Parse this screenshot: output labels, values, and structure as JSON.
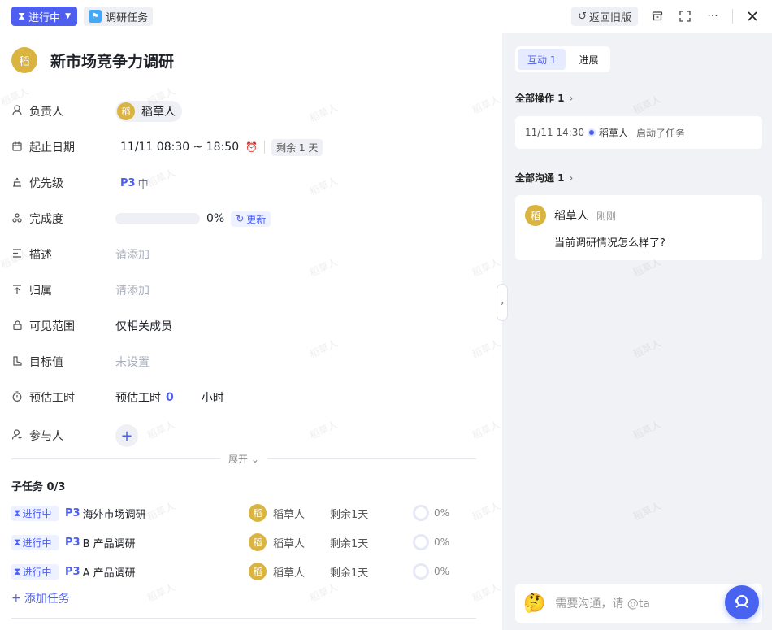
{
  "topbar": {
    "status": "进行中",
    "task_tag": "调研任务",
    "back_label": "返回旧版"
  },
  "task": {
    "avatar_char": "稻",
    "title": "新市场竞争力调研"
  },
  "fields": {
    "owner": {
      "label": "负责人",
      "avatar_char": "稻",
      "name": "稻草人"
    },
    "dates": {
      "label": "起止日期",
      "value": "11/11 08:30 ~ 18:50",
      "remaining": "剩余 1 天"
    },
    "priority": {
      "label": "优先级",
      "level": "P3",
      "text": "中"
    },
    "completion": {
      "label": "完成度",
      "percent": "0%",
      "progress_fraction": 0,
      "update": "更新"
    },
    "description": {
      "label": "描述",
      "placeholder": "请添加"
    },
    "belongs": {
      "label": "归属",
      "placeholder": "请添加"
    },
    "visibility": {
      "label": "可见范围",
      "value": "仅相关成员"
    },
    "target": {
      "label": "目标值",
      "placeholder": "未设置"
    },
    "estimate": {
      "label": "预估工时",
      "prefix": "预估工时",
      "number": "0",
      "unit": "小时"
    },
    "participants": {
      "label": "参与人",
      "add": "+"
    }
  },
  "expand_label": "展开",
  "subtasks": {
    "header": "子任务 0/3",
    "items": [
      {
        "status": "进行中",
        "priority": "P3",
        "name": "海外市场调研",
        "avatar_char": "稻",
        "owner": "稻草人",
        "remaining": "剩余1天",
        "progress": "0%"
      },
      {
        "status": "进行中",
        "priority": "P3",
        "name": "B 产品调研",
        "avatar_char": "稻",
        "owner": "稻草人",
        "remaining": "剩余1天",
        "progress": "0%"
      },
      {
        "status": "进行中",
        "priority": "P3",
        "name": "A 产品调研",
        "avatar_char": "稻",
        "owner": "稻草人",
        "remaining": "剩余1天",
        "progress": "0%"
      }
    ],
    "add_label": "添加任务"
  },
  "right": {
    "tabs": [
      {
        "label": "互动 1"
      },
      {
        "label": "进展"
      }
    ],
    "operations": {
      "title": "全部操作 1",
      "item": {
        "time": "11/11 14:30",
        "user": "稻草人",
        "action": "启动了任务"
      }
    },
    "communication": {
      "title": "全部沟通 1",
      "comment": {
        "avatar_char": "稻",
        "name": "稻草人",
        "time": "刚刚",
        "text": "当前调研情况怎么样了?"
      }
    },
    "input_placeholder": "需要沟通，请 @ta"
  },
  "watermark": "稻草人",
  "colors": {
    "accent": "#4e5ff0",
    "avatar": "#d9b441",
    "panel_bg": "#f0f2f6"
  }
}
